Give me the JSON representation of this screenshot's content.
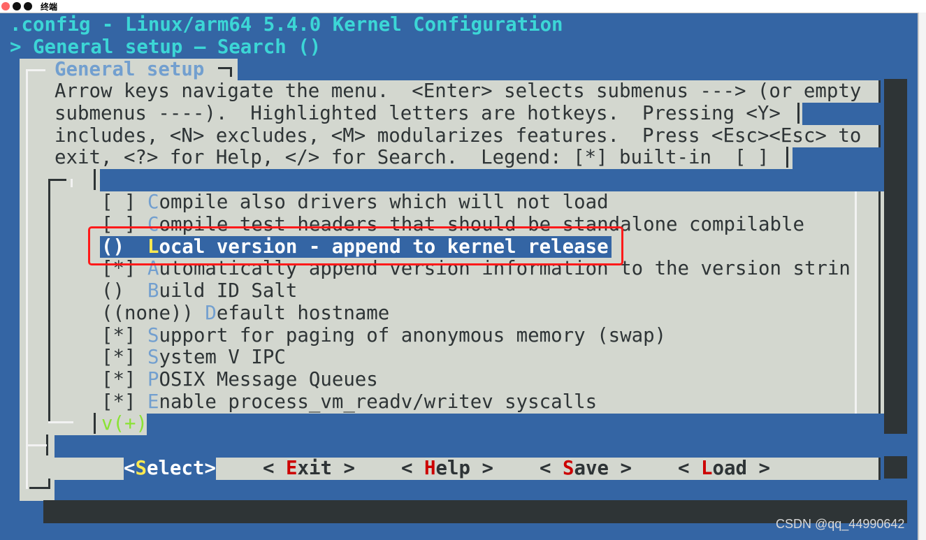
{
  "window": {
    "title": "终端"
  },
  "header": {
    "title": ".config - Linux/arm64 5.4.0 Kernel Configuration",
    "breadcrumb": "> General setup — Search ()"
  },
  "dialog": {
    "title": "General setup",
    "help_lines": [
      "Arrow keys navigate the menu.  <Enter> selects submenus ---> (or empty",
      "submenus ----).  Highlighted letters are hotkeys.  Pressing <Y>",
      "includes, <N> excludes, <M> modularizes features.  Press <Esc><Esc> to",
      "exit, <?> for Help, </> for Search.  Legend: [*] built-in  [ ]"
    ]
  },
  "menu": {
    "items": [
      {
        "prefix": "[ ]",
        "hotkey": "C",
        "rest": "ompile also drivers which will not load",
        "selected": false
      },
      {
        "prefix": "[ ]",
        "hotkey": "C",
        "rest": "ompile test headers that should be standalone compilable",
        "selected": false
      },
      {
        "prefix": "()",
        "hotkey": "L",
        "rest": "ocal version - append to kernel release",
        "selected": true
      },
      {
        "prefix": "[*]",
        "hotkey": "A",
        "rest": "utomatically append version information to the version strin",
        "selected": false
      },
      {
        "prefix": "()",
        "hotkey": "B",
        "rest": "uild ID Salt",
        "selected": false
      },
      {
        "prefix": "((none))",
        "hotkey": "D",
        "rest": "efault hostname",
        "selected": false
      },
      {
        "prefix": "[*]",
        "hotkey": "S",
        "rest": "upport for paging of anonymous memory (swap)",
        "selected": false
      },
      {
        "prefix": "[*]",
        "hotkey": "S",
        "rest": "ystem V IPC",
        "selected": false
      },
      {
        "prefix": "[*]",
        "hotkey": "P",
        "rest": "OSIX Message Queues",
        "selected": false
      },
      {
        "prefix": "[*]",
        "hotkey": "E",
        "rest": "nable process_vm_readv/writev syscalls",
        "selected": false
      }
    ],
    "more_indicator": "v(+)"
  },
  "buttons": [
    {
      "name": "select",
      "hotkey": "S",
      "rest": "elect",
      "selected": true
    },
    {
      "name": "exit",
      "hotkey": "E",
      "rest": "xit",
      "selected": false
    },
    {
      "name": "help",
      "hotkey": "H",
      "rest": "elp",
      "selected": false
    },
    {
      "name": "save",
      "hotkey": "S",
      "rest": "ave",
      "selected": false
    },
    {
      "name": "load",
      "hotkey": "L",
      "rest": "oad",
      "selected": false
    }
  ],
  "watermark": "CSDN @qq_44990642",
  "colors": {
    "terminal_bg": "#3465a4",
    "dialog_bg": "#d3d7cf",
    "title_text": "#3cd6d6",
    "hotkey": "#729fcf",
    "selected_hotkey": "#fce94f",
    "button_hotkey": "#cc0000",
    "annotation": "#ff1a1a"
  }
}
